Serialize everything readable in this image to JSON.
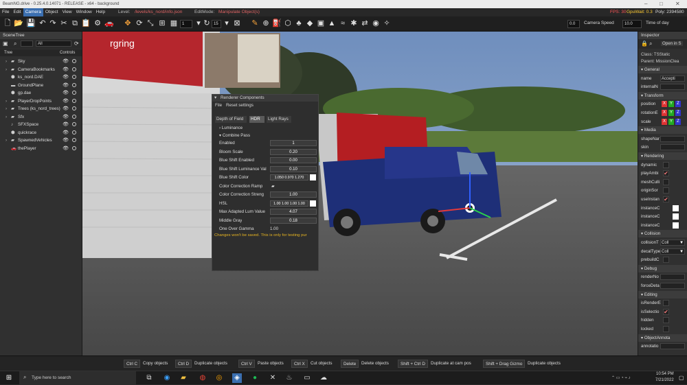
{
  "window": {
    "title": "BeamNG.drive - 0.25.4.0.14071 - RELEASE - x64 - background",
    "minimize": "–",
    "maximize": "□",
    "close": "✕"
  },
  "menu": {
    "items": [
      "File",
      "Edit",
      "Camera",
      "Object",
      "View",
      "Window",
      "Help"
    ],
    "active": "Camera",
    "level_label": "Level:",
    "level_value": "/levels/ks_nord/info.json",
    "editmode_label": "EditMode:",
    "editmode_value": "Manipulate Object(s)",
    "fps": "FPS: 30",
    "gpu": "GpuWait: 0.3",
    "poly": "Poly: 2394580"
  },
  "toolbar": {
    "snap_value": "1",
    "angle_value": "15",
    "camera_speed_value": "0.0",
    "camera_speed_label": "Camera Speed",
    "time_value": "10.0",
    "time_label": "Time of day"
  },
  "scenetree": {
    "title": "SceneTree",
    "filter": "All",
    "col_tree": "Tree",
    "col_controls": "Controls",
    "items": [
      {
        "label": "Sky",
        "icon": "folder-icon",
        "arrow": "›"
      },
      {
        "label": "CameraBookmarks",
        "icon": "folder-icon",
        "arrow": "›"
      },
      {
        "label": "ks_nord.DAE",
        "icon": "mesh-icon",
        "arrow": ""
      },
      {
        "label": "GroundPlane",
        "icon": "plane-icon",
        "arrow": ""
      },
      {
        "label": "gp.dae",
        "icon": "mesh-icon",
        "arrow": ""
      },
      {
        "label": "PlayerDropPoints",
        "icon": "folder-icon",
        "arrow": "›"
      },
      {
        "label": "Trees (ks_nord_trees)",
        "icon": "folder-icon",
        "arrow": "›"
      },
      {
        "label": "Sfx",
        "icon": "folder-icon",
        "arrow": "›"
      },
      {
        "label": "SFXSpace",
        "icon": "sound-icon",
        "arrow": ""
      },
      {
        "label": "quickrace",
        "icon": "mesh-icon",
        "arrow": ""
      },
      {
        "label": "SpawnedVehicles",
        "icon": "folder-icon",
        "arrow": "›"
      },
      {
        "label": "thePlayer",
        "icon": "car-icon",
        "arrow": ""
      }
    ]
  },
  "inspector": {
    "title": "Inspector",
    "open_button": "Open in S",
    "class_line": "Class: TSStatic",
    "parent_line": "Parent: MissionClea",
    "rows": [
      {
        "type": "section",
        "label": "General"
      },
      {
        "type": "field",
        "label": "name",
        "value": "Accepti"
      },
      {
        "type": "field",
        "label": "internalN",
        "value": ""
      },
      {
        "type": "section",
        "label": "Transform"
      },
      {
        "type": "xyz",
        "label": "position"
      },
      {
        "type": "xyz",
        "label": "rotationE"
      },
      {
        "type": "xyz",
        "label": "scale"
      },
      {
        "type": "section",
        "label": "Media"
      },
      {
        "type": "field",
        "label": "shapeNar",
        "value": ""
      },
      {
        "type": "field",
        "label": "skin",
        "value": ""
      },
      {
        "type": "section",
        "label": "Rendering"
      },
      {
        "type": "check",
        "label": "dynamic",
        "checked": false
      },
      {
        "type": "check",
        "label": "playAmbi",
        "checked": true
      },
      {
        "type": "check",
        "label": "meshCulli",
        "checked": false
      },
      {
        "type": "check",
        "label": "originSor",
        "checked": false
      },
      {
        "type": "check",
        "label": "useInstan",
        "checked": true
      },
      {
        "type": "swatch",
        "label": "instanceC"
      },
      {
        "type": "swatch",
        "label": "instanceC"
      },
      {
        "type": "swatch",
        "label": "instanceC"
      },
      {
        "type": "section",
        "label": "Collision"
      },
      {
        "type": "select",
        "label": "collisionT",
        "value": "Coll"
      },
      {
        "type": "select",
        "label": "decalType",
        "value": "Coll"
      },
      {
        "type": "check",
        "label": "prebuildC",
        "checked": false
      },
      {
        "type": "section",
        "label": "Debug"
      },
      {
        "type": "field",
        "label": "renderNo",
        "value": ""
      },
      {
        "type": "field",
        "label": "forceDeta",
        "value": ""
      },
      {
        "type": "section",
        "label": "Editing"
      },
      {
        "type": "check",
        "label": "isRenderE",
        "checked": false
      },
      {
        "type": "check",
        "label": "isSelectio",
        "checked": true
      },
      {
        "type": "check",
        "label": "hidden",
        "checked": false
      },
      {
        "type": "check",
        "label": "locked",
        "checked": false
      },
      {
        "type": "section",
        "label": "ObjectAnnota"
      },
      {
        "type": "field",
        "label": "annotatio",
        "value": ""
      }
    ],
    "xyz_labels": [
      "X",
      "Y",
      "Z"
    ]
  },
  "render_components": {
    "title": "Renderer Components",
    "menu": [
      "File",
      "Reset settings"
    ],
    "tabs": [
      "Depth of Field",
      "HDR",
      "Light Rays"
    ],
    "active_tab": "HDR",
    "groups": [
      "Luminance",
      "Combine Pass"
    ],
    "rows": [
      {
        "label": "Enabled",
        "value": "1",
        "kind": "slider"
      },
      {
        "label": "Bloom Scale",
        "value": "0.20",
        "kind": "slider"
      },
      {
        "label": "Blue Shift Enabled",
        "value": "0.00",
        "kind": "slider"
      },
      {
        "label": "Blue Shift Luminance Val",
        "value": "0.10",
        "kind": "slider"
      },
      {
        "label": "Blue Shift Color",
        "value": "1.050 0.970 1.270",
        "kind": "color"
      },
      {
        "label": "Color Correction Ramp",
        "value": "",
        "kind": "folder"
      },
      {
        "label": "Color Correction Streng",
        "value": "1.00",
        "kind": "slider"
      },
      {
        "label": "HSL",
        "value": "1.00 1.00 1.00 1.00",
        "kind": "color"
      },
      {
        "label": "Max Adapted Lum Value",
        "value": "4.07",
        "kind": "slider"
      },
      {
        "label": "Middle Gray",
        "value": "0.18",
        "kind": "slider"
      },
      {
        "label": "One Over Gamma",
        "value": "1.00",
        "kind": "plain"
      }
    ],
    "warning": "Changes won't be saved. This is only for testing pur"
  },
  "shortcuts": [
    {
      "key": "Ctrl C",
      "desc": "Copy objects"
    },
    {
      "key": "Ctrl D",
      "desc": "Duplicate objects"
    },
    {
      "key": "Ctrl V",
      "desc": "Paste objects"
    },
    {
      "key": "Ctrl X",
      "desc": "Cut objects"
    },
    {
      "key": "Delete",
      "desc": "Delete objects"
    },
    {
      "key": "Shift + Ctrl D",
      "desc": "Duplicate at cam pos"
    },
    {
      "key": "Shift + Drag Gizmo",
      "desc": "Duplicate objects"
    }
  ],
  "taskbar": {
    "search_placeholder": "Type here to search",
    "time": "10:54 PM",
    "date": "7/21/2022"
  },
  "scene": {
    "sign_text": "rgring"
  }
}
